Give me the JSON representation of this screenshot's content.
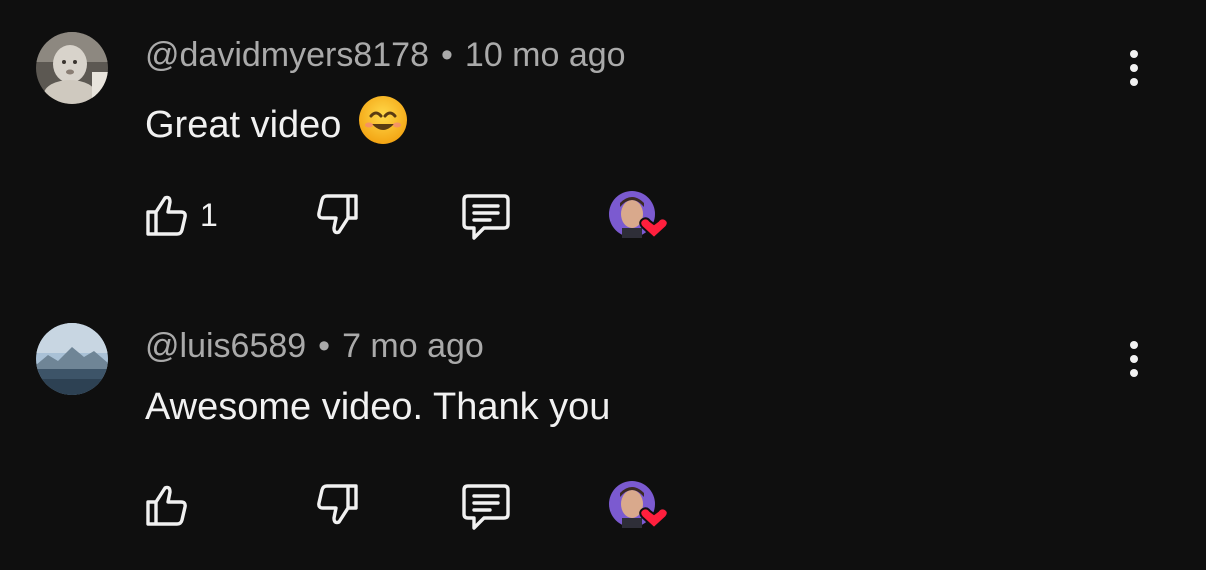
{
  "comments": [
    {
      "handle": "@davidmyers8178",
      "separator": "•",
      "time": "10 mo ago",
      "text": "Great video",
      "emoji": "smiling-face-emoji",
      "like_count": "1",
      "avatar": "baby-photo-avatar"
    },
    {
      "handle": "@luis6589",
      "separator": "•",
      "time": "7 mo ago",
      "text": "Awesome video. Thank you",
      "like_count": "",
      "avatar": "mountain-landscape-avatar"
    }
  ],
  "icons": {
    "like": "thumbs-up-icon",
    "dislike": "thumbs-down-icon",
    "reply": "reply-comment-icon",
    "more": "more-vertical-icon",
    "creator_heart": "creator-heart-badge"
  },
  "colors": {
    "background": "#0f0f0f",
    "text_primary": "#f1f1f1",
    "text_secondary": "#aaaaaa",
    "heart": "#ff1f3d",
    "creator_avatar_bg": "#7b5ad0"
  }
}
